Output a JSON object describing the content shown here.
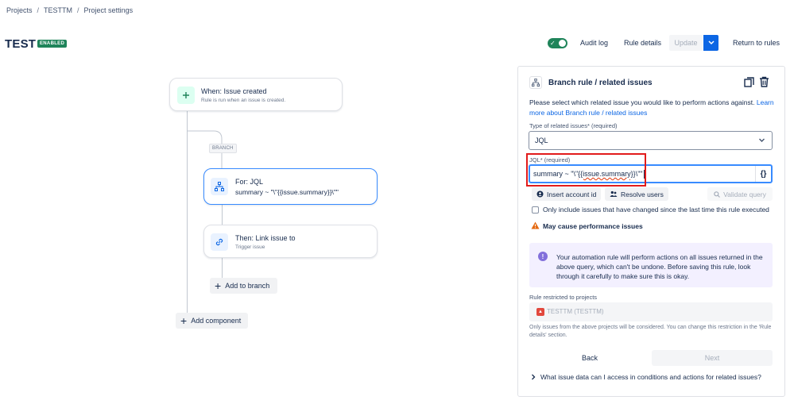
{
  "breadcrumb": {
    "items": [
      "Projects",
      "TESTTM",
      "Project settings"
    ],
    "separator": "/"
  },
  "rule": {
    "title": "TEST",
    "status_badge": "ENABLED"
  },
  "header": {
    "audit_log": "Audit log",
    "rule_details": "Rule details",
    "update": "Update",
    "return": "Return to rules",
    "toggle_on": true
  },
  "canvas": {
    "trigger": {
      "title": "When: Issue created",
      "subtitle": "Rule is run when an issue is created."
    },
    "branch_tag": "BRANCH",
    "branch": {
      "title": "For: JQL",
      "subtitle": "summary ~ \"\\\"{{issue.summary}}\\\"\""
    },
    "action": {
      "title": "Then: Link issue to",
      "subtitle": "Trigger issue"
    },
    "add_to_branch": "Add to branch",
    "add_component": "Add component"
  },
  "panel": {
    "title": "Branch rule / related issues",
    "description": "Please select which related issue you would like to perform actions against.",
    "learn_more": "Learn more about Branch rule / related issues",
    "type_label": "Type of related issues",
    "type_required": "* (required)",
    "type_value": "JQL",
    "jql_label": "JQL",
    "jql_required": "* (required)",
    "jql_prefix": "summary ~ \"\\\"",
    "jql_squiggle": "{{issue.summary}}",
    "jql_suffix": "\\\"\"",
    "smart_values_button": "{}",
    "insert_account_id": "Insert account id",
    "resolve_users": "Resolve users",
    "validate_query": "Validate query",
    "checkbox_label": "Only include issues that have changed since the last time this rule executed",
    "checkbox_checked": false,
    "warning": "May cause performance issues",
    "info_text": "Your automation rule will perform actions on all issues returned in the above query, which can't be undone. Before saving this rule, look through it carefully to make sure this is okay.",
    "restricted_label": "Rule restricted to projects",
    "restricted_project": "TESTTM (TESTTM)",
    "help_text": "Only issues from the above projects will be considered. You can change this restriction in the 'Rule details' section.",
    "back": "Back",
    "next": "Next",
    "faq": "What issue data can I access in conditions and actions for related issues?"
  },
  "colors": {
    "accent": "#0c66e4",
    "enabled_green": "#1f845a",
    "highlight_red": "#e21b1b",
    "info_bg": "#f3f0ff",
    "warning": "#e56910"
  }
}
